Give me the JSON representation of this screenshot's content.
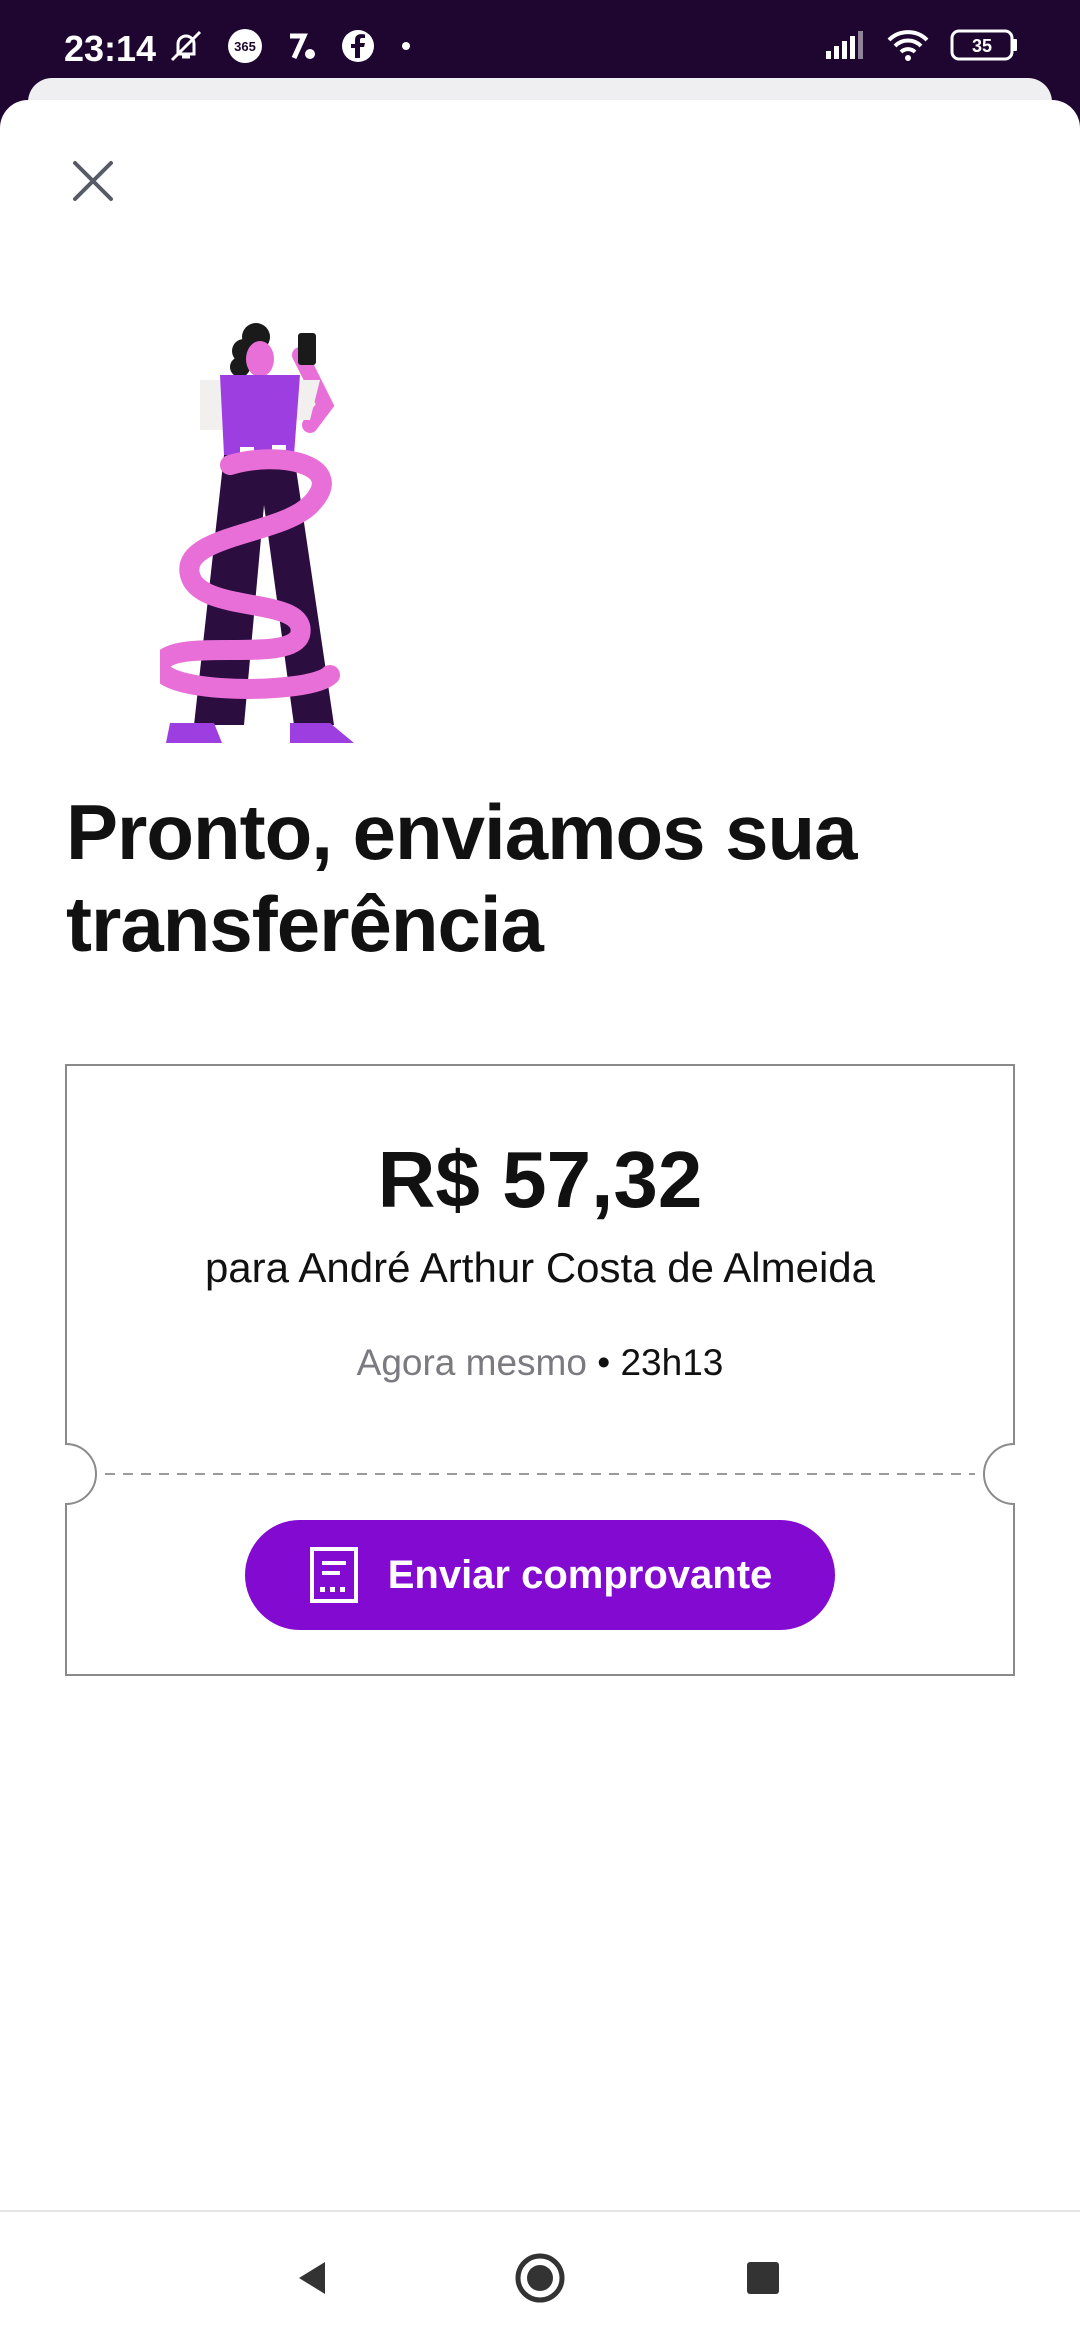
{
  "status_bar": {
    "time": "23:14",
    "left_icons": [
      "muted-bell-icon",
      "365-app-icon",
      "percent-app-icon",
      "facebook-icon",
      "dot-icon"
    ],
    "right_icons": [
      "signal-icon",
      "wifi-icon",
      "battery-icon"
    ],
    "battery_level": "35"
  },
  "sheet": {
    "close_icon": "close-icon",
    "title": "Pronto, enviamos sua transferência"
  },
  "receipt": {
    "amount": "R$ 57,32",
    "recipient": "para André Arthur Costa de Almeida",
    "when_label": "Agora mesmo",
    "when_separator": " • ",
    "when_time": "23h13",
    "button_label": "Enviar comprovante",
    "button_icon": "receipt-icon"
  },
  "colors": {
    "brand_purple": "#820ad1",
    "status_bar_bg": "#1e0630",
    "secondary_text": "#7a7a80"
  },
  "nav": {
    "icons": [
      "back-icon",
      "home-icon",
      "recents-icon"
    ]
  }
}
